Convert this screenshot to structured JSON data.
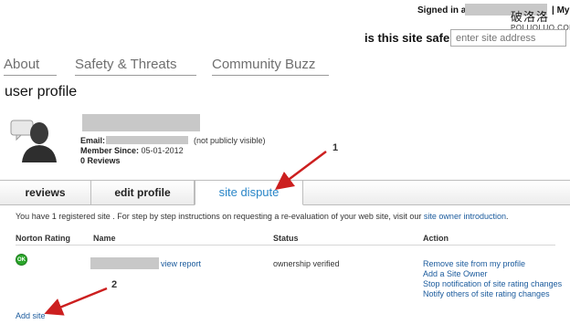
{
  "header": {
    "signed_in_label": "Signed in as",
    "my_link": "My P",
    "watermark_cn": "破洛洛",
    "watermark_en": "POLUOLUO.COM",
    "safe_question": "is this site safe?",
    "search_placeholder": "enter site address"
  },
  "nav": {
    "items": [
      "About",
      "Safety & Threats",
      "Community Buzz"
    ]
  },
  "page_title": "user profile",
  "profile": {
    "email_label": "Email:",
    "email_note": "(not publicly visible)",
    "member_since_label": "Member Since:",
    "member_since_value": "05-01-2012",
    "reviews_count": "0 Reviews"
  },
  "tabs": [
    "reviews",
    "edit profile",
    "site dispute"
  ],
  "annotations": {
    "marker1": "1",
    "marker2": "2"
  },
  "content": {
    "intro_text": "You have 1 registered site . For step by step instructions on requesting a re-evaluation of your web site, visit our",
    "intro_link": "site owner introduction",
    "intro_end": ".",
    "columns": [
      "Norton Rating",
      "Name",
      "Status",
      "Action"
    ],
    "row": {
      "rating_icon": "ok-icon",
      "rating_text": "OK",
      "view_report": "view report",
      "status": "ownership verified",
      "actions": [
        "Remove site from my profile",
        "Add a Site Owner",
        "Stop notification of site rating changes",
        "Notify others of site rating changes"
      ]
    },
    "add_site": "Add site"
  },
  "colors": {
    "link": "#1a5a9c",
    "active_tab": "#2a86c8",
    "arrow": "#cc1f1f",
    "ok_green": "#2aa62a"
  }
}
